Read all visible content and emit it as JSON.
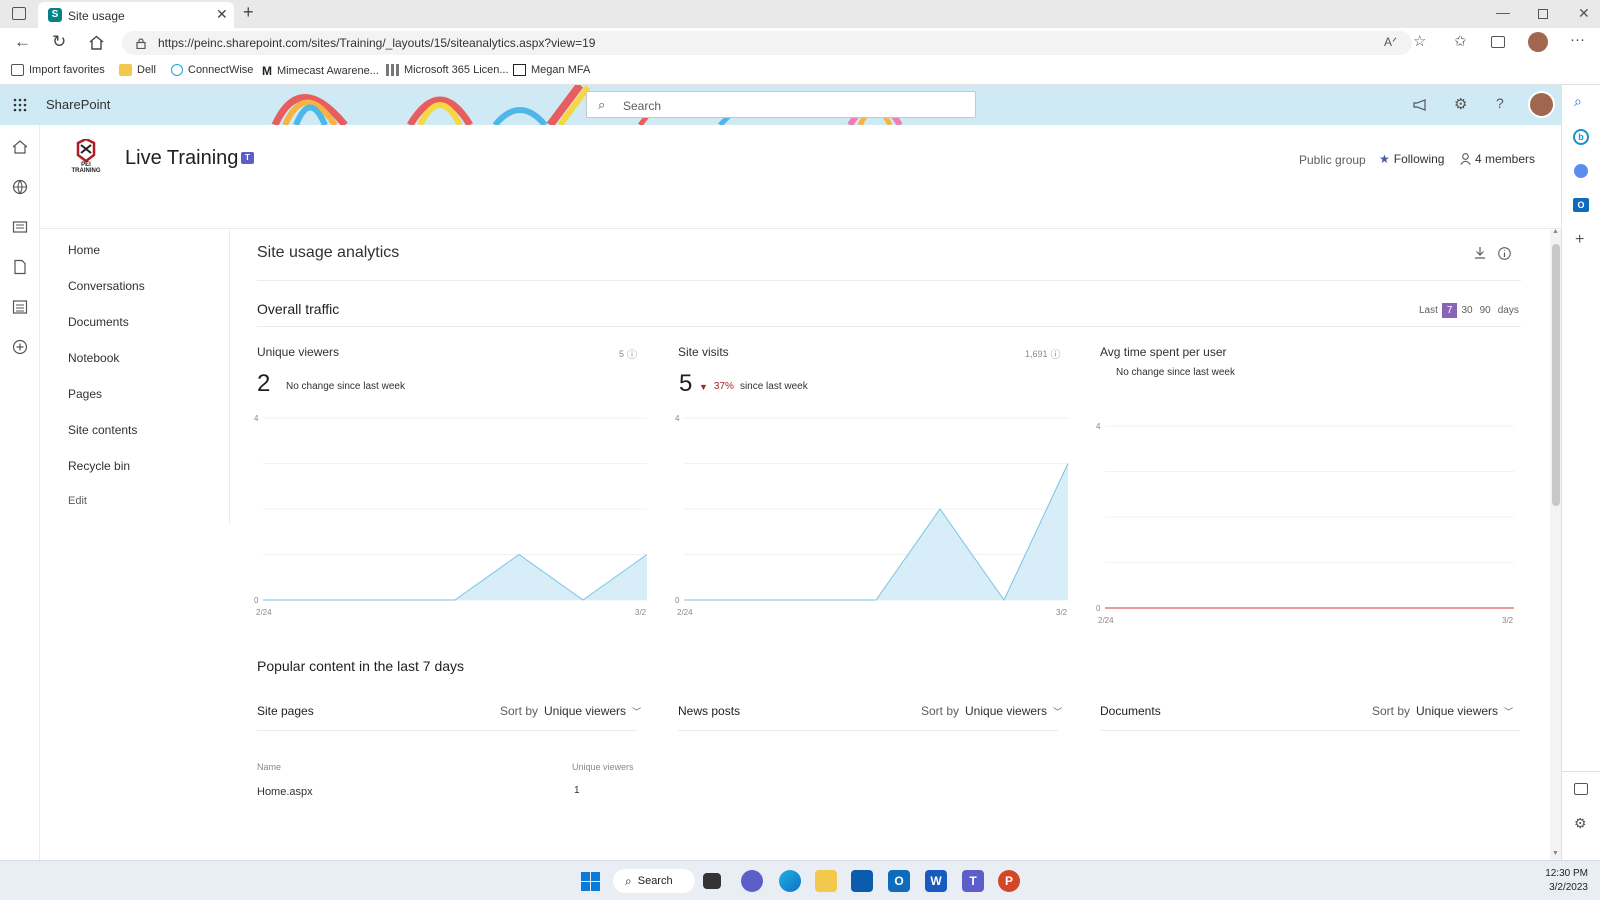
{
  "browser": {
    "tab_title": "Site usage",
    "url": "https://peinc.sharepoint.com/sites/Training/_layouts/15/siteanalytics.aspx?view=19",
    "favorites": [
      "Import favorites",
      "Dell",
      "ConnectWise",
      "Mimecast Awarene...",
      "Microsoft 365 Licen...",
      "Megan MFA"
    ]
  },
  "suitebar": {
    "app_name": "SharePoint",
    "search_placeholder": "Search"
  },
  "site": {
    "logo_text": "PEI TRAINING",
    "name": "Live Training",
    "privacy": "Public group",
    "following": "Following",
    "members": "4 members"
  },
  "nav": {
    "items": [
      "Home",
      "Conversations",
      "Documents",
      "Notebook",
      "Pages",
      "Site contents",
      "Recycle bin"
    ],
    "edit": "Edit"
  },
  "page": {
    "title": "Site usage analytics"
  },
  "traffic": {
    "title": "Overall traffic",
    "range_prefix": "Last",
    "range_options": [
      "7",
      "30",
      "90"
    ],
    "range_selected": "7",
    "range_suffix": "days",
    "accent": "#8764b8"
  },
  "cards": [
    {
      "title": "Unique viewers",
      "total": "5",
      "value": "2",
      "change_text": "No change since last week",
      "change_pct": "",
      "change_suffix": ""
    },
    {
      "title": "Site visits",
      "total": "1,691",
      "value": "5",
      "change_text": "",
      "change_pct": "37%",
      "change_suffix": "since last week"
    },
    {
      "title": "Avg time spent per user",
      "total": "",
      "value": "",
      "change_text": "No change since last week",
      "change_pct": "",
      "change_suffix": ""
    }
  ],
  "chart_data": [
    {
      "type": "area",
      "title": "Unique viewers",
      "x": [
        "2/24",
        "2/25",
        "2/26",
        "2/27",
        "2/28",
        "3/1",
        "3/2"
      ],
      "values": [
        0,
        0,
        0,
        0,
        1,
        0,
        1
      ],
      "ylim": [
        0,
        4
      ],
      "x_ticks": [
        "2/24",
        "3/2"
      ],
      "y_ticks": [
        "0",
        "4"
      ],
      "color": "#a6d8ef"
    },
    {
      "type": "area",
      "title": "Site visits",
      "x": [
        "2/24",
        "2/25",
        "2/26",
        "2/27",
        "2/28",
        "3/1",
        "3/2"
      ],
      "values": [
        0,
        0,
        0,
        0,
        2,
        0,
        3
      ],
      "ylim": [
        0,
        4
      ],
      "x_ticks": [
        "2/24",
        "3/2"
      ],
      "y_ticks": [
        "0",
        "4"
      ],
      "color": "#a6d8ef"
    },
    {
      "type": "line",
      "title": "Avg time spent per user",
      "x": [
        "2/24",
        "2/25",
        "2/26",
        "2/27",
        "2/28",
        "3/1",
        "3/2"
      ],
      "values": [
        0,
        0,
        0,
        0,
        0,
        0,
        0
      ],
      "ylim": [
        0,
        4
      ],
      "x_ticks": [
        "2/24",
        "3/2"
      ],
      "y_ticks": [
        "0",
        "4"
      ],
      "color": "#d13438"
    }
  ],
  "popular": {
    "title": "Popular content in the last 7 days",
    "sort_label": "Sort by",
    "sort_value": "Unique viewers",
    "sections": [
      "Site pages",
      "News posts",
      "Documents"
    ],
    "table_headers": [
      "Name",
      "Unique viewers"
    ],
    "rows": [
      {
        "name": "Home.aspx",
        "viewers": "1"
      }
    ]
  },
  "taskbar": {
    "search": "Search",
    "time": "12:30 PM",
    "date": "3/2/2023"
  }
}
